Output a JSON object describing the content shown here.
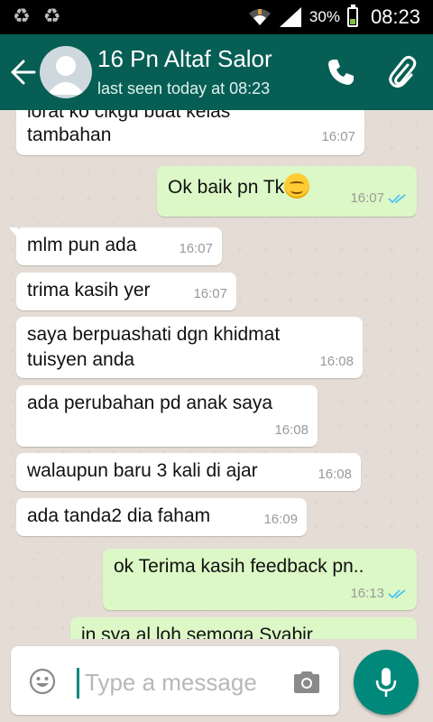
{
  "statusbar": {
    "battery": "30%",
    "time": "08:23"
  },
  "header": {
    "name": "16 Pn Altaf Salor",
    "status": "last seen today at 08:23"
  },
  "messages": [
    {
      "dir": "in",
      "text1": "lorat ko cikgu buat kelas",
      "text2": "tambahan",
      "time": "16:07"
    },
    {
      "dir": "out",
      "text": "Ok baik pn Tk",
      "emoji": "smiling-face",
      "time": "16:07",
      "ticks": "read"
    },
    {
      "dir": "in",
      "text": "mlm pun ada",
      "time": "16:07"
    },
    {
      "dir": "in",
      "text": "trima kasih yer",
      "time": "16:07"
    },
    {
      "dir": "in",
      "text1": "saya berpuashati dgn khidmat",
      "text2": "tuisyen anda",
      "time": "16:08"
    },
    {
      "dir": "in",
      "text": "ada perubahan pd anak saya",
      "time": "16:08"
    },
    {
      "dir": "in",
      "text": "walaupun baru 3 kali di ajar",
      "time": "16:08"
    },
    {
      "dir": "in",
      "text": "ada tanda2 dia faham",
      "time": "16:09"
    },
    {
      "dir": "out",
      "text": "ok Terima kasih feedback pn..",
      "time": "16:13",
      "ticks": "read"
    },
    {
      "dir": "out",
      "text": "in sya al loh semoga Syabir"
    }
  ],
  "input": {
    "placeholder": "Type a message"
  },
  "colors": {
    "header": "#075e54",
    "outgoing": "#dcf8c6",
    "incoming": "#ffffff",
    "accent": "#00897b",
    "ticks": "#4fc3f7"
  }
}
